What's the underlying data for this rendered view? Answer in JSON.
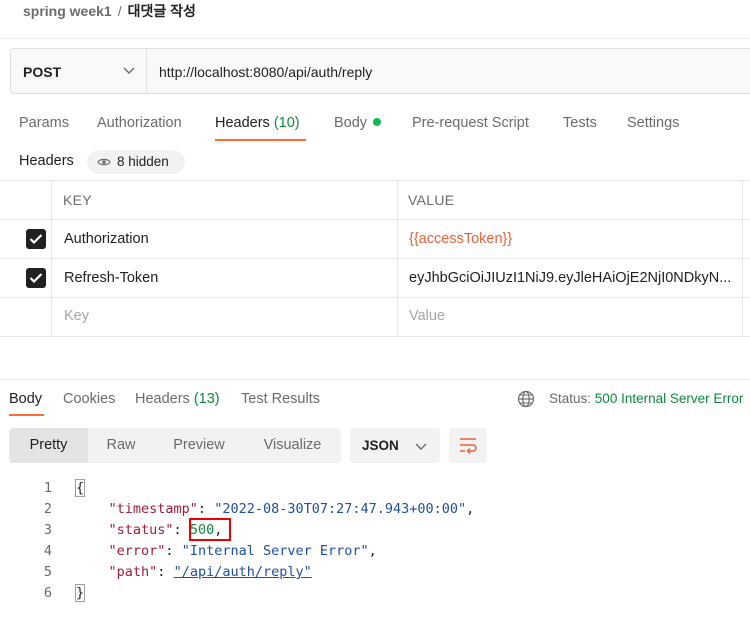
{
  "breadcrumb": {
    "parent": "spring week1",
    "separator": "/",
    "current": "대댓글 작성"
  },
  "request": {
    "method": "POST",
    "url": "http://localhost:8080/api/auth/reply"
  },
  "request_tabs": [
    {
      "label": "Params"
    },
    {
      "label": "Authorization"
    },
    {
      "label": "Headers",
      "count": "(10)"
    },
    {
      "label": "Body"
    },
    {
      "label": "Pre-request Script"
    },
    {
      "label": "Tests"
    },
    {
      "label": "Settings"
    }
  ],
  "headers_section": {
    "title": "Headers",
    "hidden_label": "8 hidden"
  },
  "headers_table": {
    "columns": [
      "KEY",
      "VALUE"
    ],
    "rows": [
      {
        "key": "Authorization",
        "value": "{{accessToken}}"
      },
      {
        "key": "Refresh-Token",
        "value": "eyJhbGciOiJIUzI1NiJ9.eyJleHAiOjE2NjI0NDkyN..."
      }
    ],
    "placeholder_key": "Key",
    "placeholder_value": "Value"
  },
  "response_tabs": [
    {
      "label": "Body"
    },
    {
      "label": "Cookies"
    },
    {
      "label": "Headers",
      "count": "(13)"
    },
    {
      "label": "Test Results"
    }
  ],
  "status": {
    "label": "Status:",
    "value": "500 Internal Server Error"
  },
  "view_modes": [
    "Pretty",
    "Raw",
    "Preview",
    "Visualize"
  ],
  "format": "JSON",
  "response_body": {
    "line_numbers": [
      "1",
      "2",
      "3",
      "4",
      "5",
      "6"
    ],
    "open_brace": "{",
    "close_brace": "}",
    "timestamp_key": "\"timestamp\"",
    "timestamp_value": "\"2022-08-30T07:27:47.943+00:00\"",
    "status_key": "\"status\"",
    "status_value": "500",
    "error_key": "\"error\"",
    "error_value": "\"Internal Server Error\"",
    "path_key": "\"path\"",
    "path_value": "\"/api/auth/reply\""
  },
  "colors": {
    "accent": "#ff6c37",
    "success": "#0d8a3f",
    "variable": "#e8613a",
    "highlight_box": "#ee0000"
  }
}
